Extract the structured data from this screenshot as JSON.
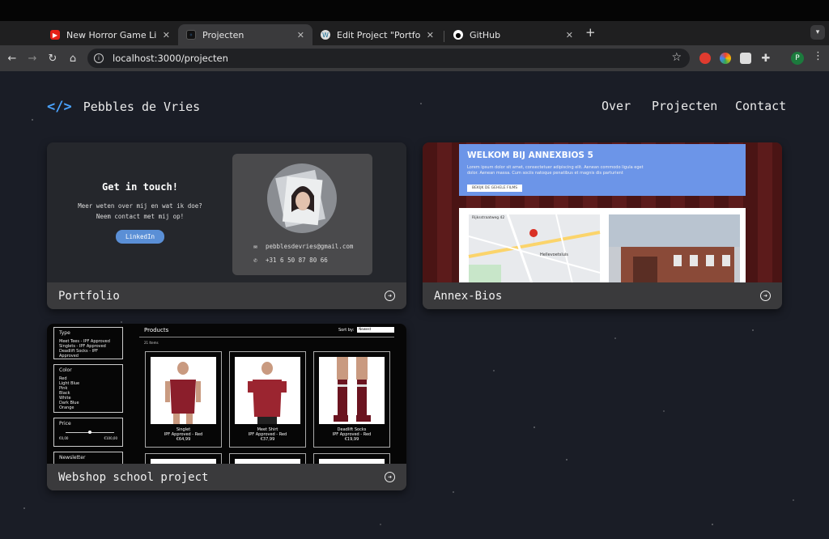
{
  "browser": {
    "tabs": [
      {
        "title": "New Horror Game Like The M",
        "active": false,
        "favicon": "youtube-icon"
      },
      {
        "title": "Projecten",
        "active": true,
        "favicon": "site-icon"
      },
      {
        "title": "Edit Project \"Portfolio\" ‹ portf",
        "active": false,
        "favicon": "wordpress-icon"
      },
      {
        "title": "GitHub",
        "active": false,
        "favicon": "github-icon"
      }
    ],
    "url": "localhost:3000/projecten",
    "profile_initial": "P"
  },
  "site": {
    "logo_mark": "</>",
    "name": "Pebbles de Vries",
    "nav": [
      "Over",
      "Projecten",
      "Contact"
    ]
  },
  "projects": [
    {
      "label": "Portfolio",
      "preview": {
        "heading": "Get in touch!",
        "text_line1": "Meer weten over mij en wat ik doe?",
        "text_line2": "Neem contact met mij op!",
        "button": "LinkedIn",
        "email": "pebblesdevries@gmail.com",
        "phone": "+31 6 50 87 80 66"
      }
    },
    {
      "label": "Annex-Bios",
      "preview": {
        "heading": "WELKOM BIJ ANNEXBIOS 5",
        "subtext": "Lorem ipsum dolor sit amet, consectetuer adipiscing elit. Aenean commodo ligula eget dolor. Aenean massa. Cum sociis natoque penatibus et magnis dis parturient",
        "button": "BEKIJK DE GEHELE FILMS",
        "address": "Rijksstraatweg 42",
        "city": "Hellevoetsluis"
      }
    },
    {
      "label": "Webshop school project",
      "preview": {
        "filter_type_title": "Type",
        "filter_types": [
          "Meet Tees - IPF Approved",
          "Singlets - IPF Approved",
          "Deadlift Socks - IPF Approved"
        ],
        "filter_color_title": "Color",
        "filter_colors": [
          "Red",
          "Light Blue",
          "Pink",
          "Black",
          "White",
          "Dark Blue",
          "Orange"
        ],
        "filter_price_title": "Price",
        "price_min": "€0,00",
        "price_max": "€100,00",
        "newsletter_title": "Newsletter",
        "products_title": "Products",
        "sort_label": "Sort by:",
        "sort_value": "Newest",
        "count": "21 Items",
        "products": [
          {
            "name": "Singlet",
            "sub": "IPF Approved - Red",
            "price": "€64,99"
          },
          {
            "name": "Meet Shirt",
            "sub": "IPF Approved - Red",
            "price": "€37,99"
          },
          {
            "name": "Deadlift Socks",
            "sub": "IPF Approved - Red",
            "price": "€19,99"
          }
        ]
      }
    }
  ]
}
